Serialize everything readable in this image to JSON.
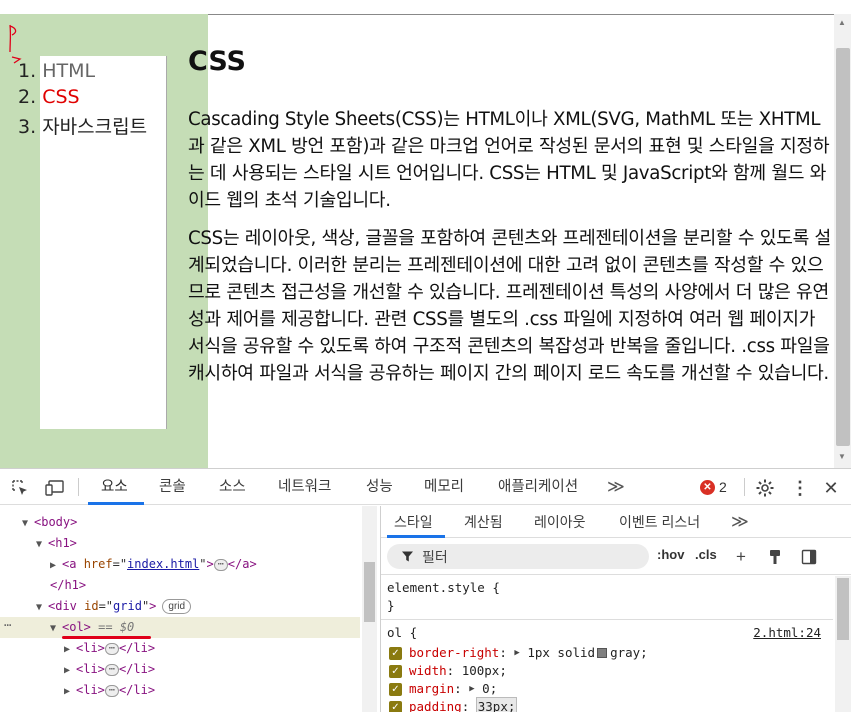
{
  "page": {
    "nav_items": [
      {
        "number": "1.",
        "label": "HTML",
        "color": "#666666"
      },
      {
        "number": "2.",
        "label": "CSS",
        "color": "#e00000"
      },
      {
        "number": "3.",
        "label": "자바스크립트",
        "color": "#222222"
      }
    ],
    "heading": "CSS",
    "paragraphs": [
      "Cascading Style Sheets(CSS)는 HTML이나 XML(SVG, MathML 또는 XHTML과 같은 XML 방언 포함)과 같은 마크업 언어로 작성된 문서의 표현 및 스타일을 지정하는 데 사용되는 스타일 시트 언어입니다. CSS는 HTML 및 JavaScript와 함께 월드 와이드 웹의 초석 기술입니다.",
      "CSS는 레이아웃, 색상, 글꼴을 포함하여 콘텐츠와 프레젠테이션을 분리할 수 있도록 설계되었습니다. 이러한 분리는 프레젠테이션에 대한 고려 없이 콘텐츠를 작성할 수 있으므로 콘텐츠 접근성을 개선할 수 있습니다. 프레젠테이션 특성의 사양에서 더 많은 유연성과 제어를 제공합니다. 관련 CSS를 별도의 .css 파일에 지정하여 여러 웹 페이지가 서식을 공유할 수 있도록 하여 구조적 콘텐츠의 복잡성과 반복을 줄입니다. .css 파일을 캐시하여 파일과 서식을 공유하는 페이지 간의 페이지 로드 속도를 개선할 수 있습니다."
    ],
    "grid_bg_color": "#c5ddb6"
  },
  "devtools": {
    "tabs": [
      "요소",
      "콘솔",
      "소스",
      "네트워크",
      "성능",
      "메모리",
      "애플리케이션"
    ],
    "active_tab": "요소",
    "more_tabs": "≫",
    "error_count": "2",
    "error_glyph": "✕",
    "dom": {
      "body": "<body>",
      "h1": "<h1>",
      "a_open": "<a ",
      "a_href_name": "href",
      "a_href_val": "index.html",
      "a_close_tag": ">",
      "a_end": "</a>",
      "h1_end": "</h1>",
      "div_open": "<div ",
      "div_id_name": "id",
      "div_id_val": "grid",
      "div_close": ">",
      "grid_badge": "grid",
      "ol": "<ol>",
      "ol_marker": "== $0",
      "li_open": "<li>",
      "li_close": "</li>",
      "ellipsis": "⋯",
      "dots": "⋯"
    },
    "styles": {
      "tabs": [
        "스타일",
        "계산됨",
        "레이아웃",
        "이벤트 리스너"
      ],
      "active_tab": "스타일",
      "more": "≫",
      "filter_placeholder": "필터",
      "hov": ":hov",
      "cls": ".cls",
      "element_style_open": "element.style {",
      "element_style_close": "}",
      "rule_selector": "ol {",
      "rule_source": "2.html:24",
      "properties": [
        {
          "name": "border-right",
          "arrow": "▶",
          "value": "1px solid",
          "swatch": "#808080",
          "value2": "gray;"
        },
        {
          "name": "width",
          "value": "100px;"
        },
        {
          "name": "margin",
          "arrow": "▶",
          "value": "0;"
        },
        {
          "name": "padding",
          "value": "33px;"
        }
      ]
    },
    "accent_color": "#1a73e8",
    "highlight_color": "#e0001a"
  }
}
